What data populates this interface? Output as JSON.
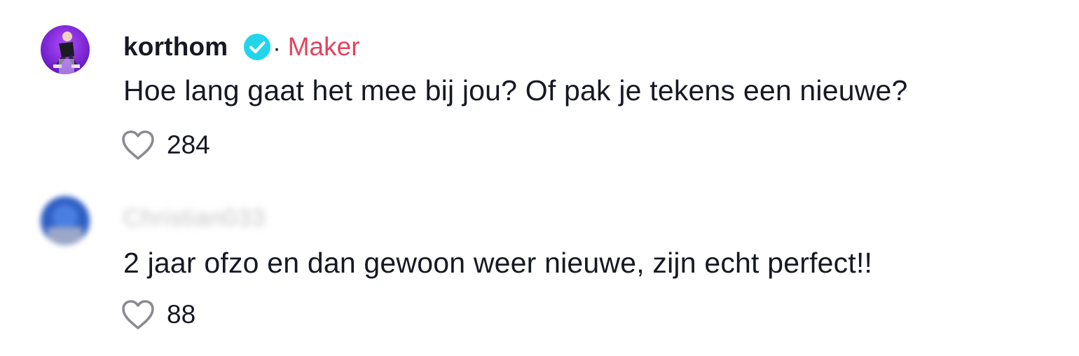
{
  "comments": [
    {
      "username": "korthom",
      "verified": true,
      "separator": "·",
      "badge": "Maker",
      "text": "Hoe lang gaat het mee bij jou? Of pak je tekens een nieuwe?",
      "likes": "284"
    },
    {
      "username": "Christian033",
      "username_blurred": true,
      "text": "2 jaar ofzo en dan gewoon weer nieuwe, zijn echt perfect!!",
      "likes": "88"
    }
  ],
  "colors": {
    "badge": "#e0455d",
    "verified": "#20d5ec",
    "text": "#161823",
    "heart_outline": "#8a8b91"
  }
}
